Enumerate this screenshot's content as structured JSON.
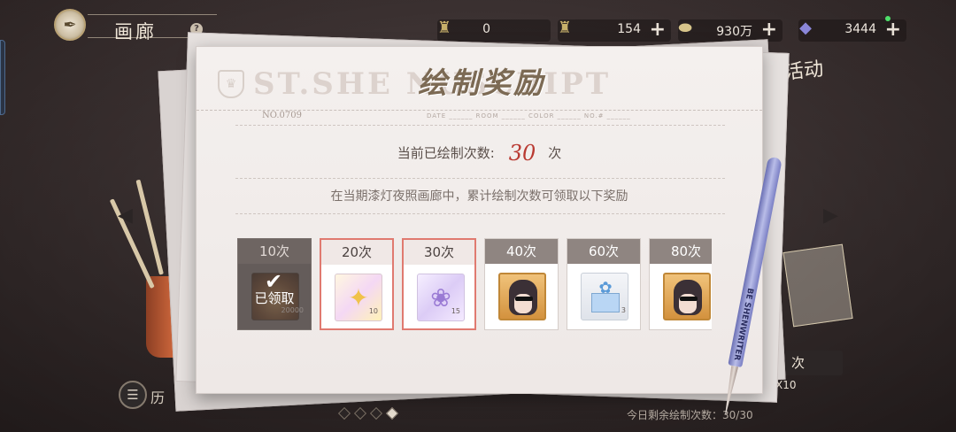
{
  "header": {
    "title": "画廊",
    "help_glyph": "?"
  },
  "currencies": [
    {
      "name": "pen-currency-a",
      "icon": "♜",
      "value": "0",
      "has_plus": false,
      "color": "#c7b06a"
    },
    {
      "name": "pen-currency-b",
      "icon": "♜",
      "value": "154",
      "has_plus": true,
      "color": "#c7b06a"
    },
    {
      "name": "coin-currency",
      "icon": "⬬",
      "value": "930万",
      "has_plus": true,
      "color": "#d7c48a"
    },
    {
      "name": "diamond-currency",
      "icon": "◆",
      "value": "3444",
      "has_plus": true,
      "color": "#8a86d8"
    }
  ],
  "side": {
    "event_label": "活动",
    "draw_label": "次",
    "draw_multiplier": "X10",
    "remaining_text": "今日剩余绘制次数：30/30",
    "history_label": "历",
    "history_glyph": "☰",
    "event_card_text": "绘制活动"
  },
  "panel": {
    "title": "绘制奖励",
    "watermark": "ST.SHE         NUSCRIPT",
    "serial": "NO.0709",
    "form_line": "DATE ______  ROOM ______  COLOR ______  NO.# ______",
    "count_label": "当前已绘制次数:",
    "count_value": "30",
    "count_unit": "次",
    "description": "在当期漆灯夜照画廊中，累计绘制次数可领取以下奖励"
  },
  "rewards": [
    {
      "label": "10次",
      "state": "claimed",
      "thumb": "coin",
      "qty": "20000",
      "claimed_text": "已领取",
      "check": "✔"
    },
    {
      "label": "20次",
      "state": "available",
      "thumb": "flower",
      "qty": "10",
      "glyph": "✦"
    },
    {
      "label": "30次",
      "state": "available",
      "thumb": "butter",
      "qty": "15",
      "glyph": "❀"
    },
    {
      "label": "40次",
      "state": "locked",
      "thumb": "avatar",
      "qty": ""
    },
    {
      "label": "60次",
      "state": "locked",
      "thumb": "gift",
      "qty": "3"
    },
    {
      "label": "80次",
      "state": "locked",
      "thumb": "avatar",
      "qty": ""
    }
  ],
  "pen_brand": "BE SHENWRITER",
  "page_dots": [
    false,
    false,
    false,
    true
  ]
}
